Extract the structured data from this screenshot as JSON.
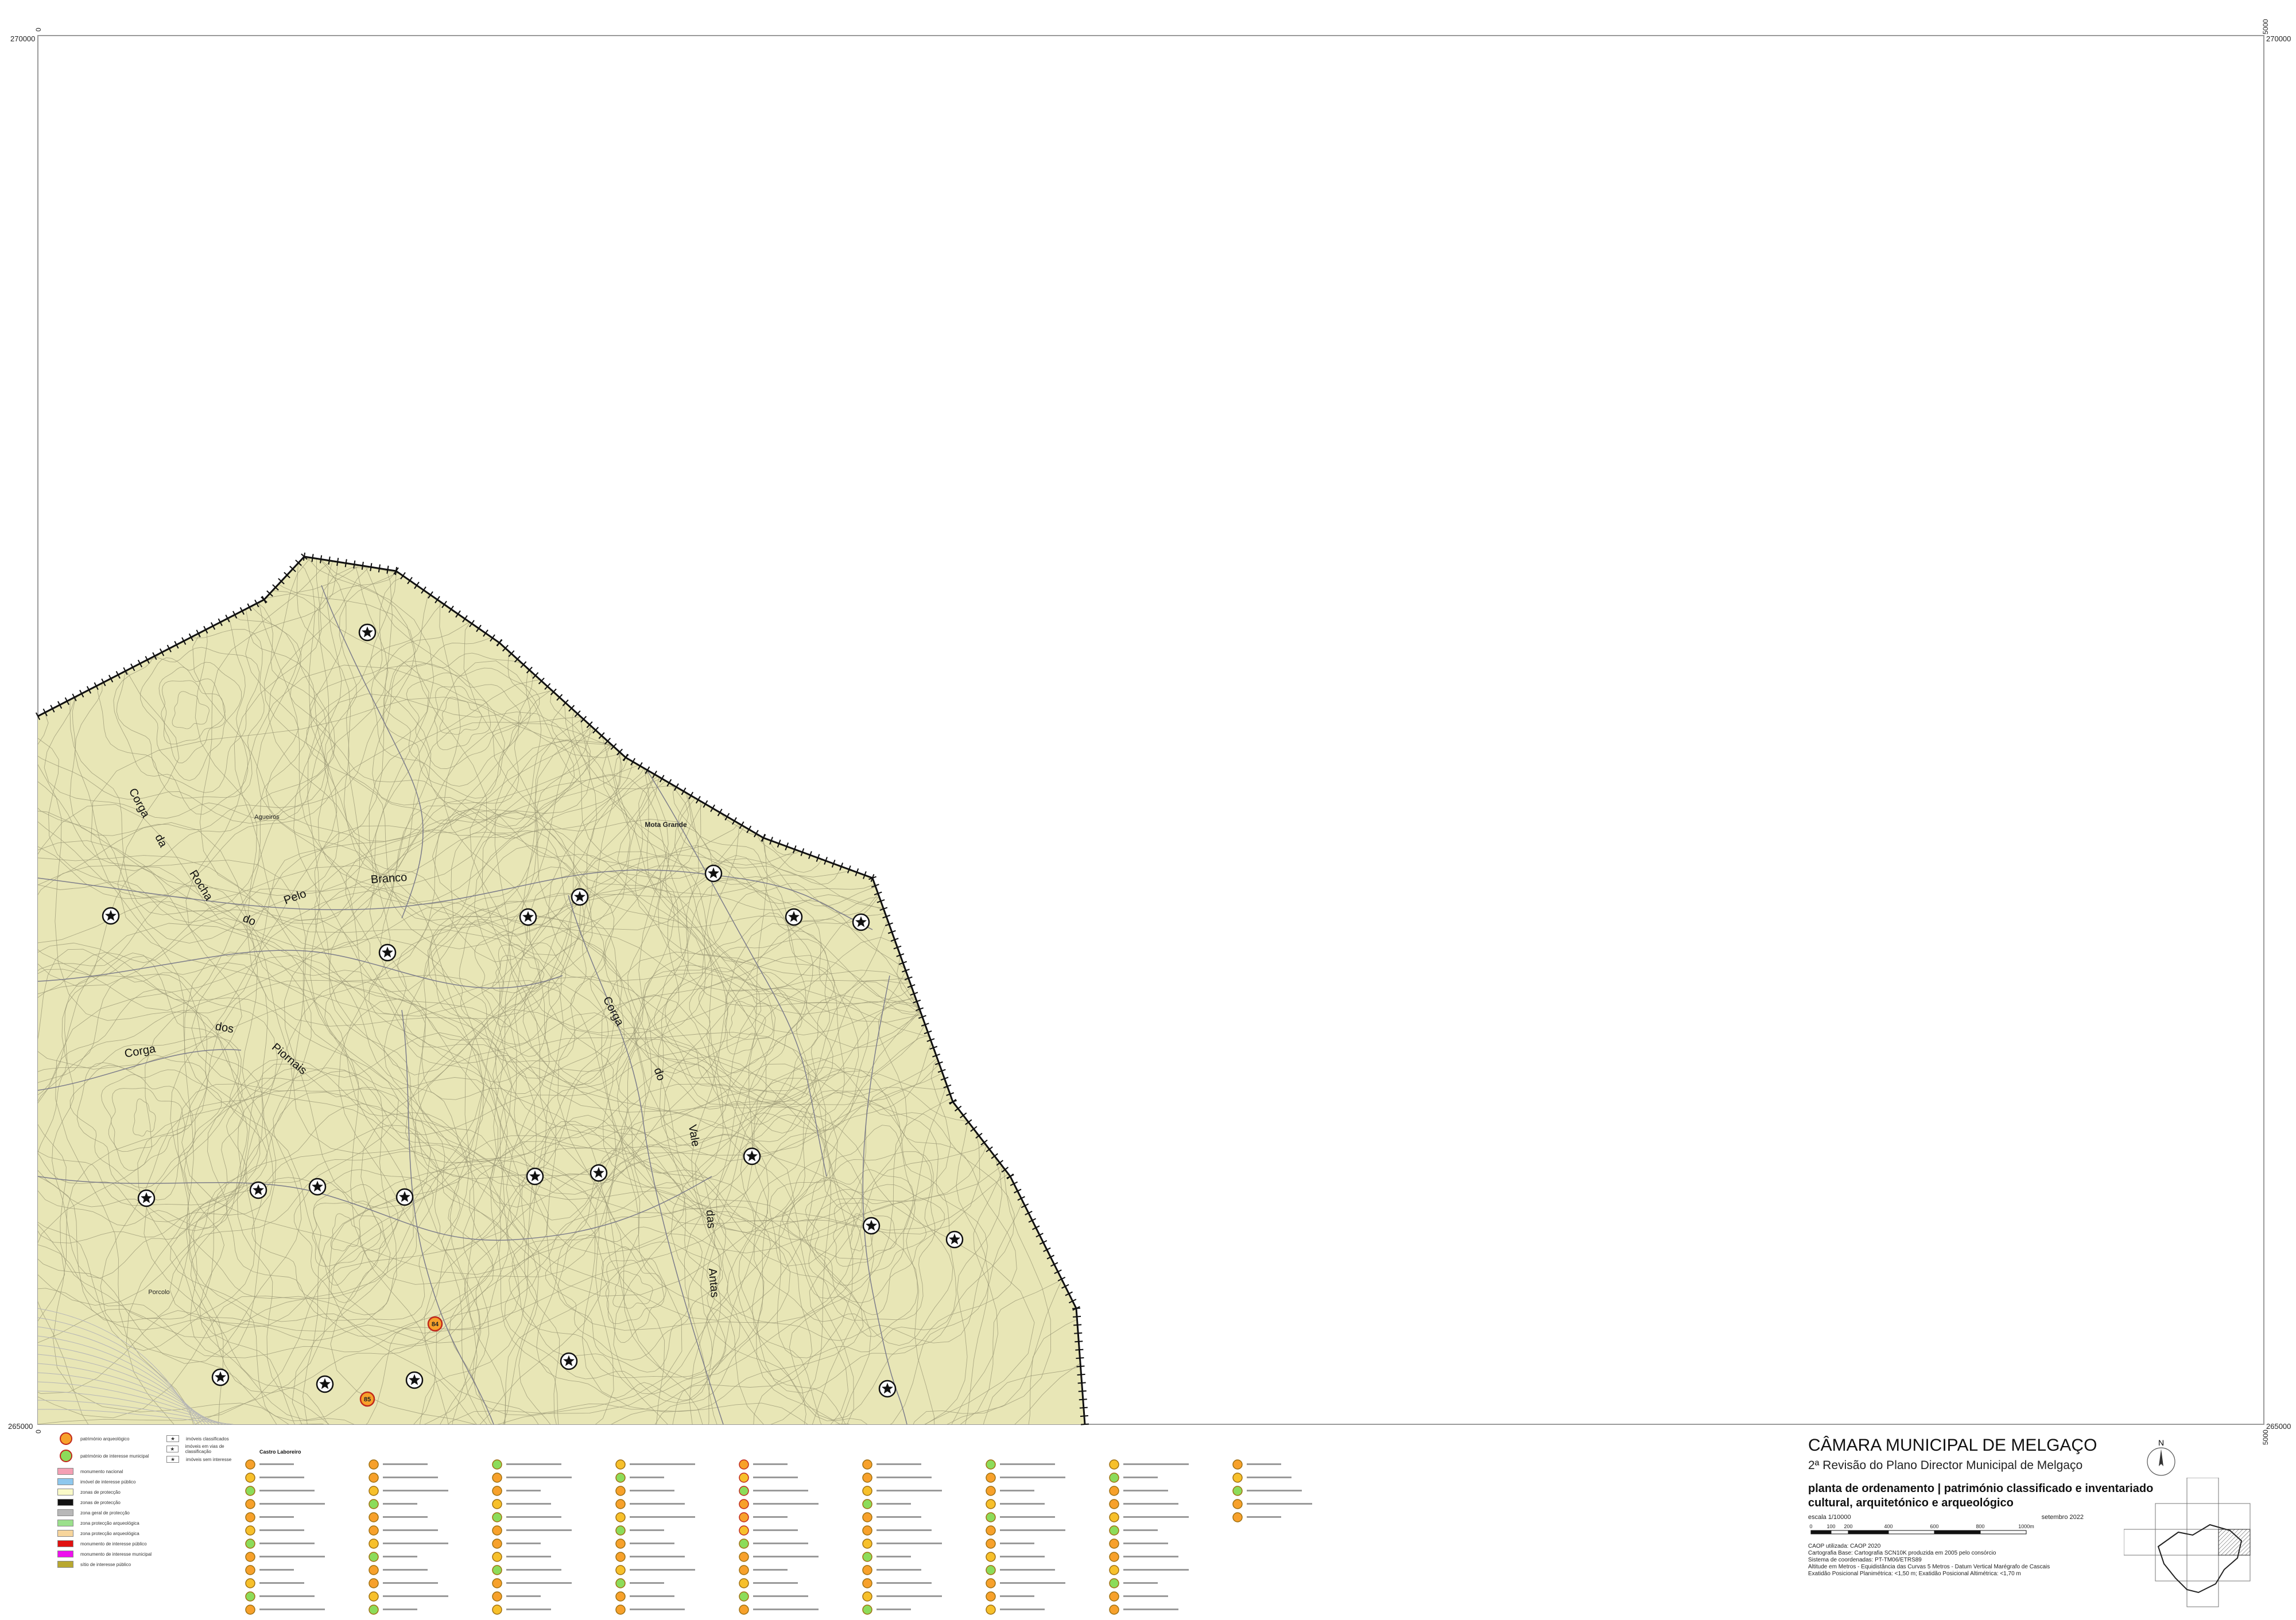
{
  "map": {
    "place_labels": [
      {
        "id": "agueiros",
        "text": "Agueiros"
      },
      {
        "id": "mota-grande",
        "text": "Mota Grande"
      },
      {
        "id": "porcolo",
        "text": "Porcolo"
      }
    ],
    "stream_labels": [
      {
        "id": "corga-rocha-1",
        "text": "Corga"
      },
      {
        "id": "corga-rocha-2",
        "text": "da"
      },
      {
        "id": "corga-rocha-3",
        "text": "Rocha"
      },
      {
        "id": "corga-rocha-4",
        "text": "do"
      },
      {
        "id": "corga-rocha-5",
        "text": "Pelo"
      },
      {
        "id": "corga-rocha-6",
        "text": "Branco"
      },
      {
        "id": "corga-piornais-1",
        "text": "Corga"
      },
      {
        "id": "corga-piornais-2",
        "text": "dos"
      },
      {
        "id": "corga-piornais-3",
        "text": "Piornais"
      },
      {
        "id": "corga-vale-1",
        "text": "Corga"
      },
      {
        "id": "corga-vale-2",
        "text": "do"
      },
      {
        "id": "corga-vale-3",
        "text": "Vale"
      },
      {
        "id": "corga-vale-4",
        "text": "das"
      },
      {
        "id": "corga-vale-5",
        "text": "Antas"
      }
    ],
    "heritage_markers": [
      {
        "num": "84",
        "color": "#f7a12b"
      },
      {
        "num": "85",
        "color": "#f7a12b"
      }
    ],
    "coords": {
      "top_left": "270000",
      "top_right": "270000",
      "bottom_left": "265000",
      "bottom_right": "265000",
      "left_top_v": "0",
      "left_bottom_v": "0",
      "right_top_v": "5000",
      "right_bottom_v": "5000"
    },
    "colors": {
      "terrain": "#e8e6b6",
      "boundary": "#111111",
      "heritage_orange": "#f7a12b",
      "heritage_green": "#8cdc5a"
    }
  },
  "legend": {
    "items": [
      {
        "label": "património arqueológico",
        "kind": "circle",
        "color": "#f7a12b"
      },
      {
        "label": "património de interesse municipal",
        "kind": "circle",
        "color": "#8cdc5a"
      },
      {
        "label": "monumento nacional",
        "kind": "box",
        "color": "#f4a0b4"
      },
      {
        "label": "imóvel de interesse público",
        "kind": "box",
        "color": "#8ec8ee"
      },
      {
        "label": "zonas de protecção",
        "kind": "box",
        "color": "#fafac8"
      },
      {
        "label": "zonas de protecção",
        "kind": "box",
        "color": "#111111"
      },
      {
        "label": "zona geral de protecção",
        "kind": "box",
        "color": "#b8b8b8"
      },
      {
        "label": "zona protecção arqueológica",
        "kind": "box",
        "color": "#9be08c"
      },
      {
        "label": "zona protecção arqueológica",
        "kind": "box",
        "color": "#f7d59c"
      },
      {
        "label": "monumento de interesse público",
        "kind": "box",
        "color": "#e01010"
      },
      {
        "label": "monumento de interesse municipal",
        "kind": "box",
        "color": "#ee10ee"
      },
      {
        "label": "sítio de interesse público",
        "kind": "box",
        "color": "#b8a830"
      }
    ],
    "star_items": [
      {
        "label": "imóveis classificados"
      },
      {
        "label": "imóveis em vias de classificação"
      },
      {
        "label": "imóveis sem interesse"
      }
    ],
    "castro_heading": "Castro Laboreiro"
  },
  "title_block": {
    "institution": "CÂMARA MUNICIPAL DE MELGAÇO",
    "subtitle": "2ª Revisão do Plano Director Municipal de Melgaço",
    "heading_line1": "planta de ordenamento | património classificado e inventariado",
    "heading_line2": "cultural, arquitetónico e arqueológico",
    "scale_label": "escala 1/10000",
    "date": "setembro 2022",
    "scale_ticks": [
      "0",
      "100",
      "200",
      "400",
      "600",
      "800",
      "1000m"
    ],
    "notes": [
      "CAOP utilizada: CAOP 2020",
      "Cartografia Base: Cartografia SCN10K produzida em 2005 pelo consórcio",
      "Sistema de coordenadas: PT-TM06/ETRS89",
      "Altitude em Metros - Equidistância das Curvas 5 Metros - Datum Vertical Marégrafo de Cascais",
      "Exatidão Posicional Planimétrica: <1,50 m; Exatidão Posicional Altimétrica: <1,70 m"
    ],
    "north_label": "N"
  }
}
